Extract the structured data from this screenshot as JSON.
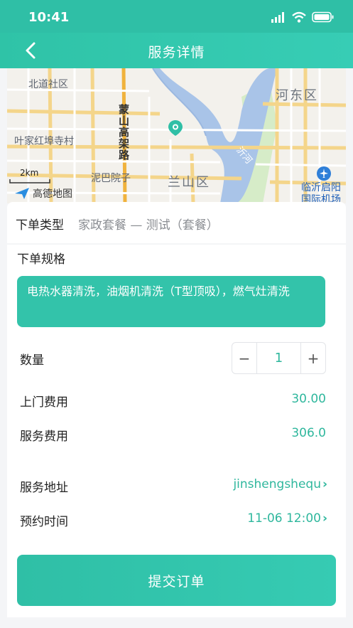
{
  "status": {
    "time": "10:41"
  },
  "nav": {
    "title": "服务详情"
  },
  "map": {
    "labels": {
      "north": "北道社区",
      "hedong": "河东区",
      "yejia": "叶家红埠寺村",
      "mengshan": "蒙山高架路",
      "niba": "泥巴院子",
      "lanshan": "兰山区",
      "yihe": "沂河",
      "scale": "2km",
      "brand": "高德地图",
      "airport": "临沂启阳国际机场"
    }
  },
  "order": {
    "type_label": "下单类型",
    "type_value": "家政套餐 — 测试（套餐）",
    "spec_label": "下单规格",
    "spec_value": "电热水器清洗，油烟机清洗（T型顶吸），燃气灶清洗",
    "quantity_label": "数量",
    "quantity_minus": "−",
    "quantity_value": "1",
    "quantity_plus": "+",
    "visit_fee_label": "上门费用",
    "visit_fee_value": "30.00",
    "service_fee_label": "服务费用",
    "service_fee_value": "306.0",
    "address_label": "服务地址",
    "address_value": "jinshengshequ",
    "time_label": "预约时间",
    "time_value": "11-06 12:00",
    "chevron": "›"
  },
  "submit_label": "提交订单",
  "colors": {
    "accent": "#2fbfa6",
    "accent_text": "#2fb79d"
  }
}
